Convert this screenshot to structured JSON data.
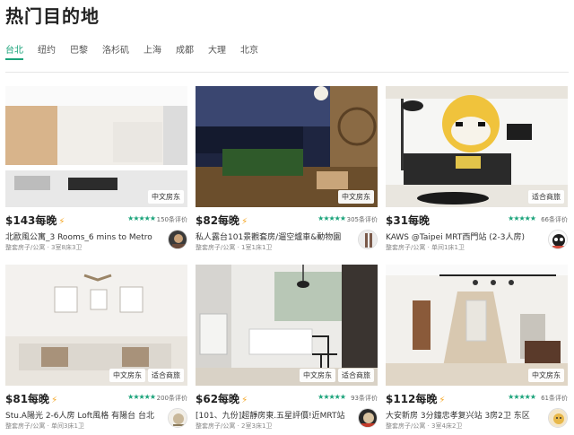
{
  "page_title": "热门目的地",
  "tabs": [
    {
      "label": "台北",
      "active": true
    },
    {
      "label": "纽约"
    },
    {
      "label": "巴黎"
    },
    {
      "label": "洛杉矶"
    },
    {
      "label": "上海"
    },
    {
      "label": "成都"
    },
    {
      "label": "大理"
    },
    {
      "label": "北京"
    }
  ],
  "colors": {
    "accent": "#1aa37a",
    "bolt": "#f5a623"
  },
  "listings": [
    {
      "price": "$143每晚",
      "instant_book": true,
      "stars": "★★★★★",
      "rating": 5,
      "reviews": "150条评价",
      "title": "北歐風公寓_3 Rooms_6 mins to Metro",
      "meta": "整套房子/公寓 · 3室8床3卫",
      "badges": [
        "中文房东"
      ]
    },
    {
      "price": "$82每晚",
      "instant_book": true,
      "stars": "★★★★★",
      "rating": 5,
      "reviews": "305条评价",
      "title": "私人露台101景觀套房/遛空爐車&動物園",
      "meta": "整套房子/公寓 · 1室1床1卫",
      "badges": [
        "中文房东"
      ]
    },
    {
      "price": "$31每晚",
      "instant_book": false,
      "stars": "★★★★★",
      "rating": 5,
      "reviews": "66条评价",
      "title": "KAWS @Taipei MRT西門站 (2-3人房)",
      "meta": "整套房子/公寓 · 单间1床1卫",
      "badges": [
        "适合商旅"
      ]
    },
    {
      "price": "$81每晚",
      "instant_book": true,
      "stars": "★★★★★",
      "rating": 5,
      "reviews": "200条评价",
      "title": "Stu.A陽光 2-6人房 Loft風格 有陽台 台北",
      "meta": "整套房子/公寓 · 单间3床1卫",
      "badges": [
        "中文房东",
        "适合商旅"
      ]
    },
    {
      "price": "$62每晚",
      "instant_book": true,
      "stars": "★★★★★",
      "rating": 5,
      "reviews": "93条评价",
      "title": "[101、九份]超靜房東.五星評價!近MRT站",
      "meta": "整套房子/公寓 · 2室3床1卫",
      "badges": [
        "中文房东",
        "适合商旅"
      ]
    },
    {
      "price": "$112每晚",
      "instant_book": true,
      "stars": "★★★★★",
      "rating": 5,
      "reviews": "61条评价",
      "title": "大安新房 3分鐘忠孝复兴站 3房2卫 东区",
      "meta": "整套房子/公寓 · 3室4床2卫",
      "badges": [
        "中文房东"
      ]
    }
  ]
}
